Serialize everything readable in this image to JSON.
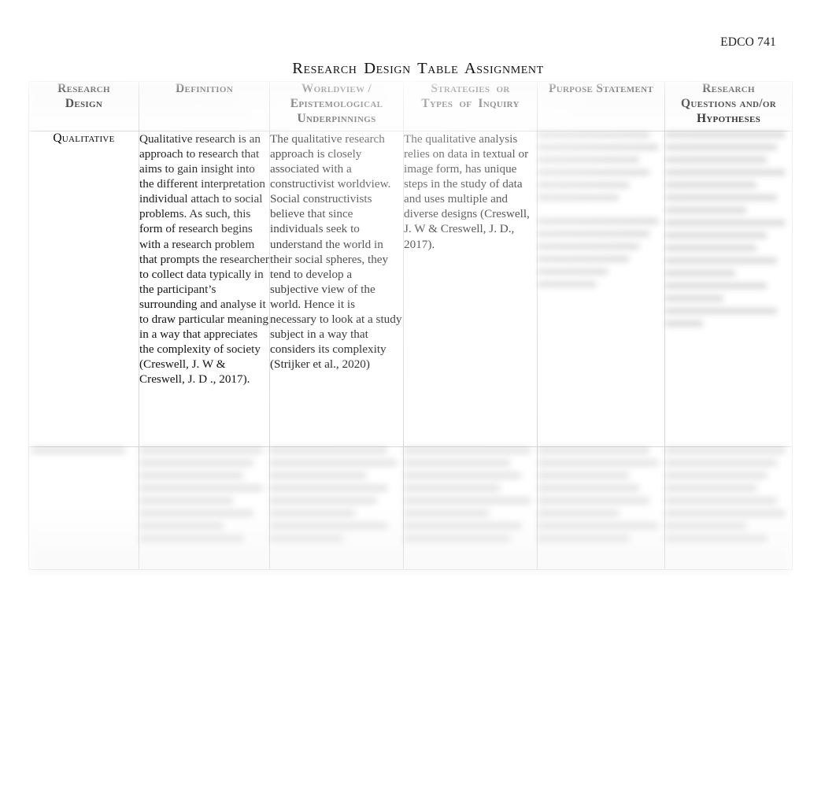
{
  "document": {
    "running_header": "EDCO 741",
    "title": "Research Design Table Assignment"
  },
  "table": {
    "columns": [
      {
        "key": "research_design",
        "header": "Research Design"
      },
      {
        "key": "definition",
        "header": "Definition"
      },
      {
        "key": "worldview",
        "header": "Worldview / Epistemological Underpinnings"
      },
      {
        "key": "strategies",
        "header": "Strategies or Types of Inquiry"
      },
      {
        "key": "purpose",
        "header": "Purpose Statement"
      },
      {
        "key": "questions",
        "header": "Research Questions and/or Hypotheses"
      }
    ],
    "header_lines": {
      "research_design": [
        "Research",
        "Design"
      ],
      "definition": [
        "Definition"
      ],
      "worldview": [
        "Worldview /",
        "Epistemological",
        "Underpinnings"
      ],
      "strategies": [
        "Strategies or",
        "Types of Inquiry"
      ],
      "purpose": [
        "Purpose Statement"
      ],
      "questions": [
        "Research",
        "Questions and/or",
        "Hypotheses"
      ]
    },
    "rows": [
      {
        "research_design": "Qualitative",
        "definition": "Qualitative research is an approach to research that aims to gain insight into the different interpretation individual attach to social problems. As such, this form of research begins with a research problem that prompts the researcher to collect data typically in the participant’s surrounding and analyse it to draw particular meaning in a way that appreciates the complexity of society (Creswell, J. W & Creswell, J. D ., 2017).",
        "worldview": "The qualitative research approach is closely associated with a constructivist worldview. Social constructivists believe that since individuals seek to understand the world in their social spheres, they tend to develop a subjective view of the world. Hence it is necessary to look at a study subject in a way that considers its complexity (Strijker et al., 2020)",
        "strategies": "The qualitative analysis relies on data in textual or image form, has unique steps in the study of data and uses multiple and diverse designs (Creswell, J. W & Creswell, J. D., 2017).",
        "purpose": "",
        "questions": "",
        "redacted_cells": [
          "purpose",
          "questions"
        ]
      },
      {
        "research_design": "",
        "definition": "",
        "worldview": "",
        "strategies": "",
        "purpose": "",
        "questions": "",
        "redacted_cells": [
          "research_design",
          "definition",
          "worldview",
          "strategies",
          "purpose",
          "questions"
        ]
      }
    ]
  },
  "appearance": {
    "page_background": "#ffffff",
    "text_color": "#111111",
    "border_color": "#d8d8d8",
    "redaction_note": "blurred-illegible"
  }
}
